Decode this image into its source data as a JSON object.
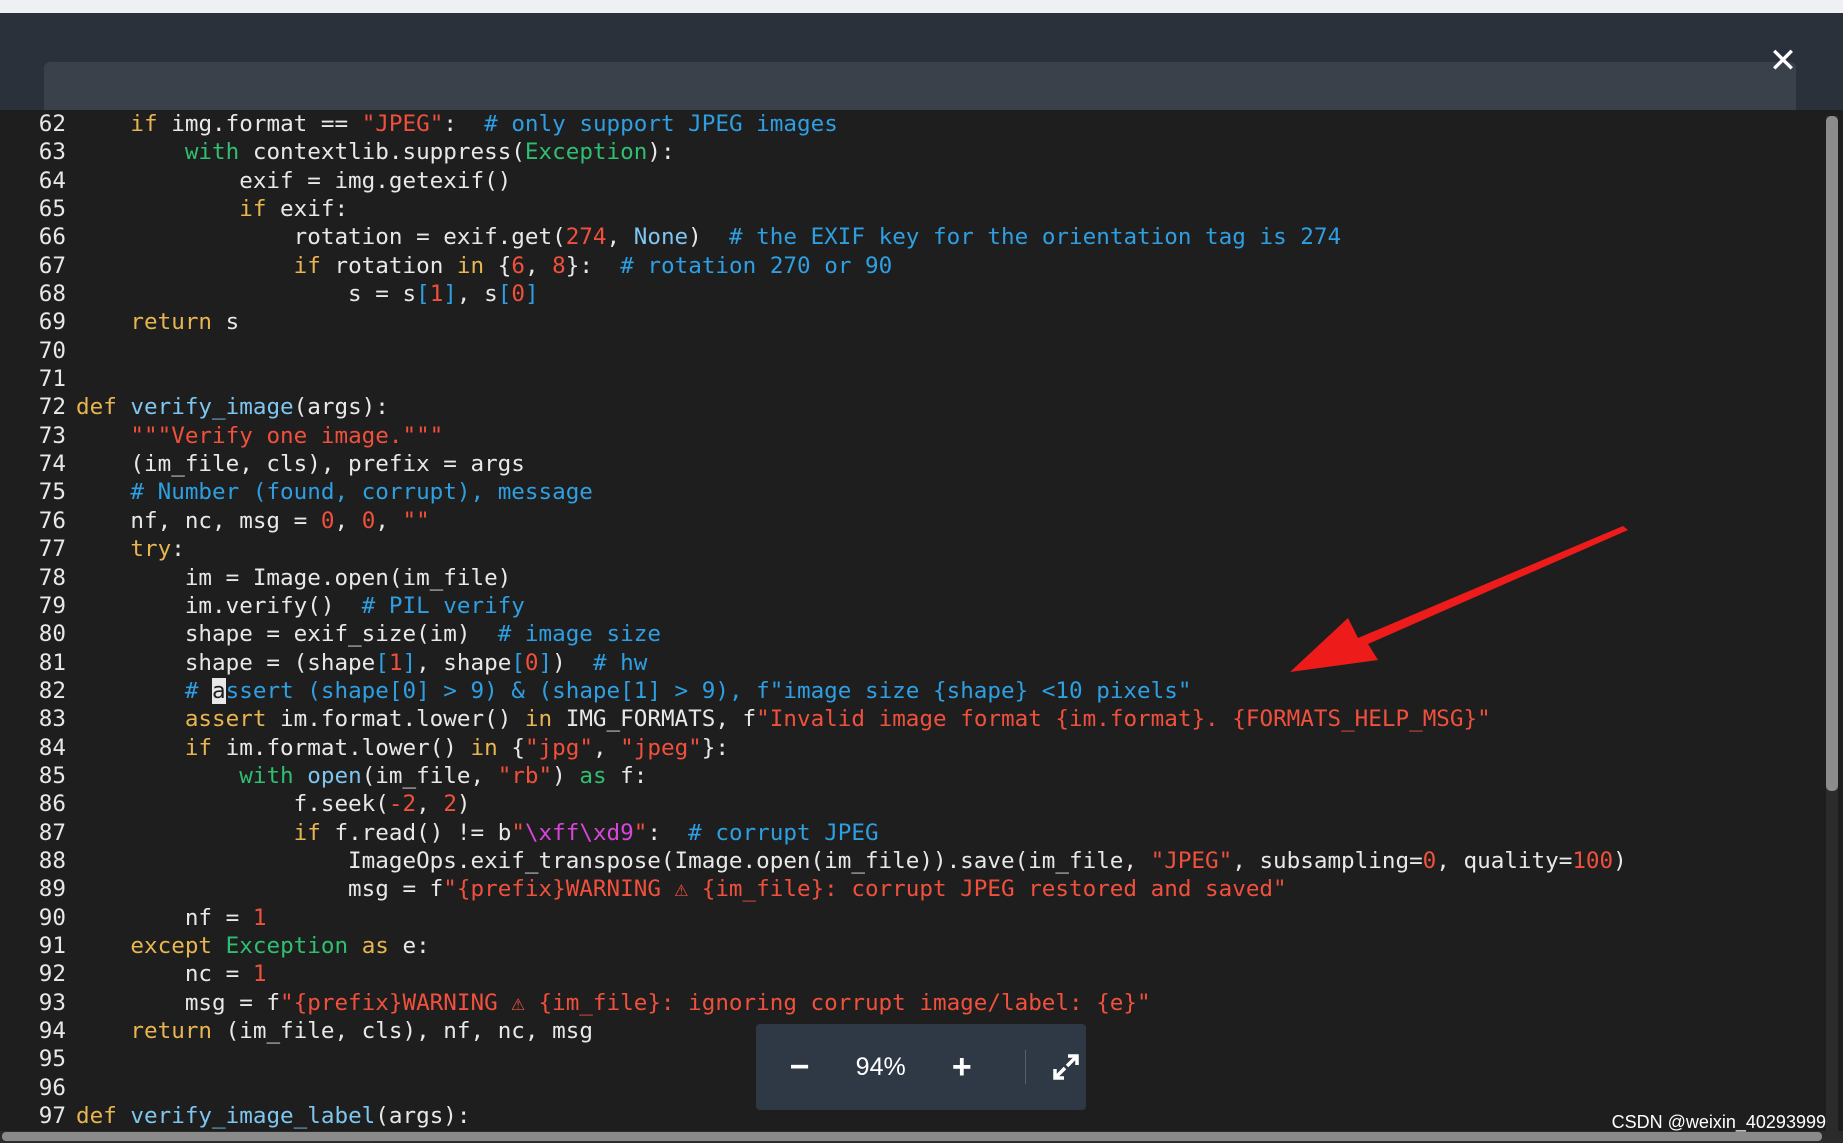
{
  "viewer": {
    "close_label": "✕",
    "zoom_out_label": "−",
    "zoom_level": "94%",
    "zoom_in_label": "+",
    "fullscreen_icon": "expand-icon",
    "watermark": "CSDN @weixin_40293999"
  },
  "colors": {
    "default": "#e8e8e8",
    "keyword": "#e8b54f",
    "function": "#7ec6ef",
    "string": "#f0503c",
    "number": "#f0503c",
    "comment": "#2e9fe2",
    "builtin": "#2fbf71",
    "bracket_index": "#2e9fe2",
    "escape": "#d945d8",
    "arrow": "#ee1b1b"
  },
  "code": {
    "cursor_line": 82,
    "lines": [
      {
        "num": "62",
        "tokens": [
          [
            "d",
            "    "
          ],
          [
            "k",
            "if"
          ],
          [
            "d",
            " img.format == "
          ],
          [
            "s",
            "\"JPEG\""
          ],
          [
            "d",
            ":  "
          ],
          [
            "c",
            "# only support JPEG images"
          ]
        ]
      },
      {
        "num": "63",
        "tokens": [
          [
            "d",
            "        "
          ],
          [
            "b",
            "with"
          ],
          [
            "d",
            " contextlib.suppress("
          ],
          [
            "b",
            "Exception"
          ],
          [
            "d",
            "):"
          ]
        ]
      },
      {
        "num": "64",
        "tokens": [
          [
            "d",
            "            exif = img.getexif()"
          ]
        ]
      },
      {
        "num": "65",
        "tokens": [
          [
            "d",
            "            "
          ],
          [
            "k",
            "if"
          ],
          [
            "d",
            " exif:"
          ]
        ]
      },
      {
        "num": "66",
        "tokens": [
          [
            "d",
            "                rotation = exif.get("
          ],
          [
            "n",
            "274"
          ],
          [
            "d",
            ", "
          ],
          [
            "f",
            "None"
          ],
          [
            "d",
            ")  "
          ],
          [
            "c",
            "# the EXIF key for the orientation tag is 274"
          ]
        ]
      },
      {
        "num": "67",
        "tokens": [
          [
            "d",
            "                "
          ],
          [
            "k",
            "if"
          ],
          [
            "d",
            " rotation "
          ],
          [
            "k",
            "in"
          ],
          [
            "d",
            " {"
          ],
          [
            "n",
            "6"
          ],
          [
            "d",
            ", "
          ],
          [
            "n",
            "8"
          ],
          [
            "d",
            "}:  "
          ],
          [
            "c",
            "# rotation 270 or 90"
          ]
        ]
      },
      {
        "num": "68",
        "tokens": [
          [
            "d",
            "                    s = s"
          ],
          [
            "c",
            "["
          ],
          [
            "n",
            "1"
          ],
          [
            "c",
            "]"
          ],
          [
            "d",
            ", s"
          ],
          [
            "c",
            "["
          ],
          [
            "n",
            "0"
          ],
          [
            "c",
            "]"
          ]
        ]
      },
      {
        "num": "69",
        "tokens": [
          [
            "d",
            "    "
          ],
          [
            "k",
            "return"
          ],
          [
            "d",
            " s"
          ]
        ]
      },
      {
        "num": "70",
        "tokens": [
          [
            "d",
            ""
          ]
        ]
      },
      {
        "num": "71",
        "tokens": [
          [
            "d",
            ""
          ]
        ]
      },
      {
        "num": "72",
        "tokens": [
          [
            "k",
            "def"
          ],
          [
            "d",
            " "
          ],
          [
            "f",
            "verify_image"
          ],
          [
            "d",
            "(args):"
          ]
        ]
      },
      {
        "num": "73",
        "tokens": [
          [
            "d",
            "    "
          ],
          [
            "s",
            "\"\"\"Verify one image.\"\"\""
          ]
        ]
      },
      {
        "num": "74",
        "tokens": [
          [
            "d",
            "    (im_file, cls), prefix = args"
          ]
        ]
      },
      {
        "num": "75",
        "tokens": [
          [
            "d",
            "    "
          ],
          [
            "c",
            "# Number (found, corrupt), message"
          ]
        ]
      },
      {
        "num": "76",
        "tokens": [
          [
            "d",
            "    nf, nc, msg = "
          ],
          [
            "n",
            "0"
          ],
          [
            "d",
            ", "
          ],
          [
            "n",
            "0"
          ],
          [
            "d",
            ", "
          ],
          [
            "s",
            "\"\""
          ]
        ]
      },
      {
        "num": "77",
        "tokens": [
          [
            "d",
            "    "
          ],
          [
            "k",
            "try"
          ],
          [
            "d",
            ":"
          ]
        ]
      },
      {
        "num": "78",
        "tokens": [
          [
            "d",
            "        im = Image.open(im_file)"
          ]
        ]
      },
      {
        "num": "79",
        "tokens": [
          [
            "d",
            "        im.verify()  "
          ],
          [
            "c",
            "# PIL verify"
          ]
        ]
      },
      {
        "num": "80",
        "tokens": [
          [
            "d",
            "        shape = exif_size(im)  "
          ],
          [
            "c",
            "# image size"
          ]
        ]
      },
      {
        "num": "81",
        "tokens": [
          [
            "d",
            "        shape = (shape"
          ],
          [
            "c",
            "["
          ],
          [
            "n",
            "1"
          ],
          [
            "c",
            "]"
          ],
          [
            "d",
            ", shape"
          ],
          [
            "c",
            "["
          ],
          [
            "n",
            "0"
          ],
          [
            "c",
            "]"
          ],
          [
            "d",
            ")  "
          ],
          [
            "c",
            "# hw"
          ]
        ]
      },
      {
        "num": "82",
        "tokens": [
          [
            "d",
            "        "
          ],
          [
            "c",
            "# "
          ],
          [
            "x",
            "a"
          ],
          [
            "c",
            "ssert (shape[0] > 9) & (shape[1] > 9), f\"image size {shape} <10 pixels\""
          ]
        ]
      },
      {
        "num": "83",
        "tokens": [
          [
            "d",
            "        "
          ],
          [
            "k",
            "assert"
          ],
          [
            "d",
            " im.format.lower() "
          ],
          [
            "k",
            "in"
          ],
          [
            "d",
            " IMG_FORMATS, f"
          ],
          [
            "s",
            "\"Invalid image format {im.format}. {FORMATS_HELP_MSG}\""
          ]
        ]
      },
      {
        "num": "84",
        "tokens": [
          [
            "d",
            "        "
          ],
          [
            "k",
            "if"
          ],
          [
            "d",
            " im.format.lower() "
          ],
          [
            "k",
            "in"
          ],
          [
            "d",
            " {"
          ],
          [
            "s",
            "\"jpg\""
          ],
          [
            "d",
            ", "
          ],
          [
            "s",
            "\"jpeg\""
          ],
          [
            "d",
            "}:"
          ]
        ]
      },
      {
        "num": "85",
        "tokens": [
          [
            "d",
            "            "
          ],
          [
            "b",
            "with"
          ],
          [
            "d",
            " "
          ],
          [
            "f",
            "open"
          ],
          [
            "d",
            "(im_file, "
          ],
          [
            "s",
            "\"rb\""
          ],
          [
            "d",
            ") "
          ],
          [
            "b",
            "as"
          ],
          [
            "d",
            " f:"
          ]
        ]
      },
      {
        "num": "86",
        "tokens": [
          [
            "d",
            "                f.seek("
          ],
          [
            "n",
            "-2"
          ],
          [
            "d",
            ", "
          ],
          [
            "n",
            "2"
          ],
          [
            "d",
            ")"
          ]
        ]
      },
      {
        "num": "87",
        "tokens": [
          [
            "d",
            "                "
          ],
          [
            "k",
            "if"
          ],
          [
            "d",
            " f.read() != b"
          ],
          [
            "s",
            "\""
          ],
          [
            "e",
            "\\xff\\xd9"
          ],
          [
            "s",
            "\""
          ],
          [
            "d",
            ":  "
          ],
          [
            "c",
            "# corrupt JPEG"
          ]
        ]
      },
      {
        "num": "88",
        "tokens": [
          [
            "d",
            "                    ImageOps.exif_transpose(Image.open(im_file)).save(im_file, "
          ],
          [
            "s",
            "\"JPEG\""
          ],
          [
            "d",
            ", subsampling="
          ],
          [
            "n",
            "0"
          ],
          [
            "d",
            ", quality="
          ],
          [
            "n",
            "100"
          ],
          [
            "d",
            ")"
          ]
        ]
      },
      {
        "num": "89",
        "tokens": [
          [
            "d",
            "                    msg = f"
          ],
          [
            "s",
            "\"{prefix}WARNING ⚠ {im_file}: corrupt JPEG restored and saved\""
          ]
        ]
      },
      {
        "num": "90",
        "tokens": [
          [
            "d",
            "        nf = "
          ],
          [
            "n",
            "1"
          ]
        ]
      },
      {
        "num": "91",
        "tokens": [
          [
            "d",
            "    "
          ],
          [
            "k",
            "except"
          ],
          [
            "d",
            " "
          ],
          [
            "b",
            "Exception"
          ],
          [
            "d",
            " "
          ],
          [
            "k",
            "as"
          ],
          [
            "d",
            " e:"
          ]
        ]
      },
      {
        "num": "92",
        "tokens": [
          [
            "d",
            "        nc = "
          ],
          [
            "n",
            "1"
          ]
        ]
      },
      {
        "num": "93",
        "tokens": [
          [
            "d",
            "        msg = f"
          ],
          [
            "s",
            "\"{prefix}WARNING ⚠ {im_file}: ignoring corrupt image/label: {e}\""
          ]
        ]
      },
      {
        "num": "94",
        "tokens": [
          [
            "d",
            "    "
          ],
          [
            "k",
            "return"
          ],
          [
            "d",
            " (im_file, cls), nf, nc, msg"
          ]
        ]
      },
      {
        "num": "95",
        "tokens": [
          [
            "d",
            ""
          ]
        ]
      },
      {
        "num": "96",
        "tokens": [
          [
            "d",
            ""
          ]
        ]
      },
      {
        "num": "97",
        "tokens": [
          [
            "k",
            "def"
          ],
          [
            "d",
            " "
          ],
          [
            "f",
            "verify_image_label"
          ],
          [
            "d",
            "(args):"
          ]
        ]
      }
    ]
  }
}
